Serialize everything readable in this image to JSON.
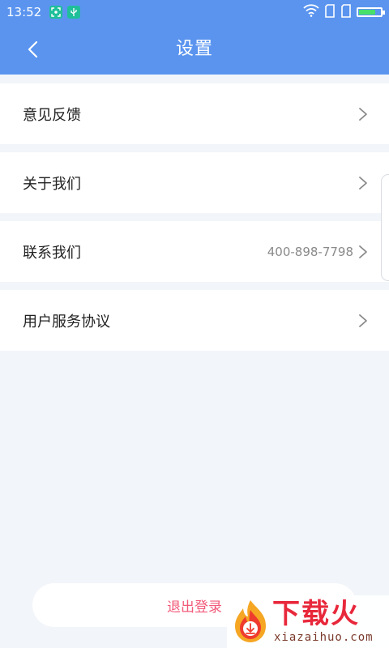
{
  "status_bar": {
    "time": "13:52",
    "icons": [
      "scan-icon",
      "usb-icon",
      "wifi-icon",
      "sim-card-icon",
      "sim-card-icon",
      "battery-icon"
    ],
    "battery_level": 0.85
  },
  "header": {
    "title": "设置",
    "back_icon": "chevron-left-icon"
  },
  "settings": {
    "items": [
      {
        "label": "意见反馈",
        "value": ""
      },
      {
        "label": "关于我们",
        "value": ""
      },
      {
        "label": "联系我们",
        "value": "400-898-7798"
      },
      {
        "label": "用户服务协议",
        "value": ""
      }
    ],
    "chevron_icon": "chevron-right-icon"
  },
  "logout": {
    "label": "退出登录"
  },
  "watermark": {
    "brand": "下载火",
    "domain": "xiazaihuo.com"
  },
  "colors": {
    "header_bg": "#5a94ef",
    "page_bg": "#f2f5f9",
    "logout_text": "#f25b7a",
    "watermark_red": "#e8283b"
  }
}
